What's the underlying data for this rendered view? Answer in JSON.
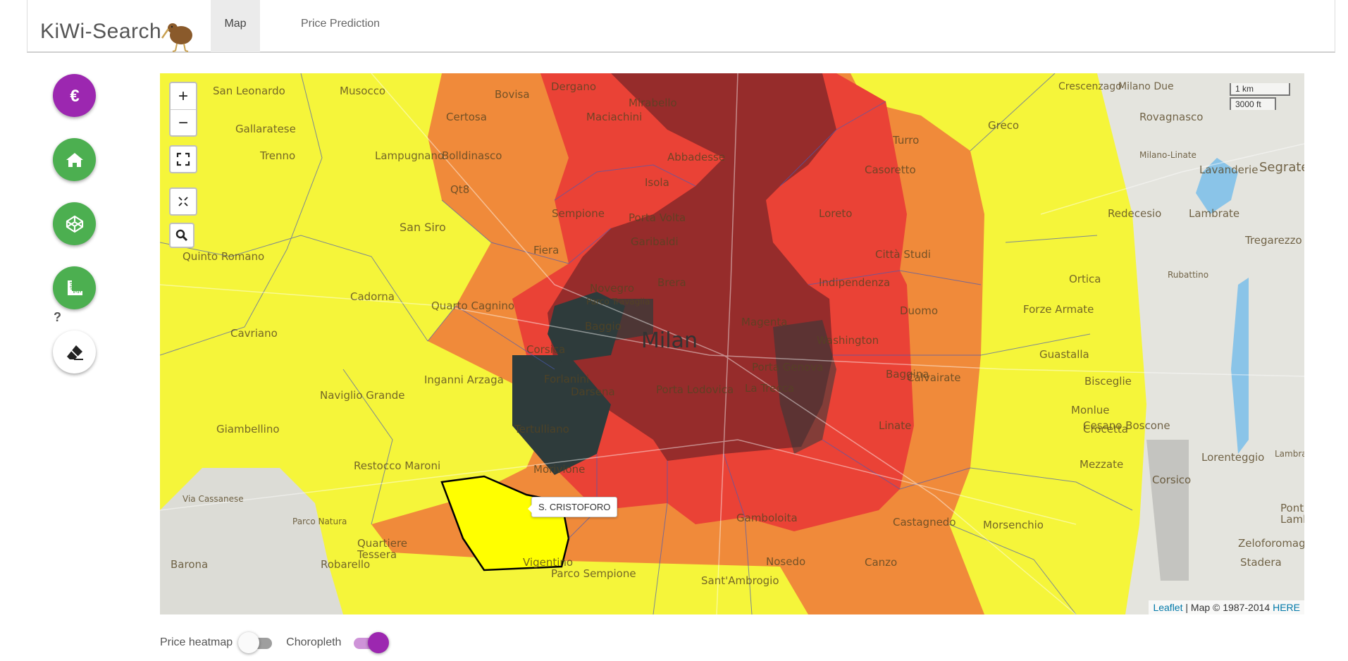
{
  "app": {
    "brand": "KiWi-Search",
    "tabs": [
      {
        "label": "Map",
        "active": true
      },
      {
        "label": "Price Prediction",
        "active": false
      }
    ]
  },
  "sidebar": {
    "buttons": [
      {
        "name": "price-button",
        "icon": "euro-icon",
        "color": "#9c27b0"
      },
      {
        "name": "home-button",
        "icon": "home-icon",
        "color": "#4caf50"
      },
      {
        "name": "codepen-button",
        "icon": "cube-icon",
        "color": "#4caf50"
      },
      {
        "name": "measure-button",
        "icon": "ruler-icon",
        "color": "#4caf50"
      },
      {
        "name": "eraser-button",
        "icon": "eraser-icon",
        "color": "#ffffff"
      }
    ],
    "help": "?"
  },
  "map": {
    "zoom_in": "+",
    "zoom_out": "−",
    "scale_km": "1 km",
    "scale_ft": "3000 ft",
    "attribution_link": "Leaflet",
    "attribution_text": " | Map © 1987-2014 ",
    "attribution_here": "HERE",
    "tooltip": "S. CRISTOFORO",
    "city_label": "Milan",
    "labels": [
      "San Leonardo",
      "Musocco",
      "Dergano",
      "Bovisa",
      "Mirabello",
      "Greco",
      "Crescenzago",
      "Milano Due",
      "Rovagnasco",
      "Certosa",
      "Maciachini",
      "Gallaratese",
      "Bolldinasco",
      "Turro",
      "Segrate",
      "Lavanderie",
      "Trenno",
      "Lampugnano",
      "Abbadesse",
      "Casoretto",
      "Isola",
      "Qt8",
      "Sempione",
      "Porta Volta",
      "Loreto",
      "Lambrate",
      "Redecesio",
      "Tregarezzo",
      "San Siro",
      "Garibaldi",
      "Città Studi",
      "Fiera",
      "Quinto Romano",
      "Brera",
      "Indipendenza",
      "Ortica",
      "Novegro",
      "Cadorna",
      "Quarto Cagnino",
      "Forze Armate",
      "Cavriano",
      "Baggio",
      "Magenta",
      "Duomo",
      "Corsica",
      "Washington",
      "Guastalla",
      "Forlanini",
      "Porta Genova",
      "Crocetta",
      "Calvairate",
      "Baggina",
      "Inganni Arzaga",
      "Bisceglie",
      "Naviglio Grande",
      "Darsena",
      "Porta Lodovica",
      "La Trecca",
      "Monlue",
      "Cesano Boscone",
      "Giambellino",
      "Tertulliano",
      "Linate",
      "Lorenteggio",
      "Restocco Maroni",
      "Morivione",
      "Gamboloita",
      "Castagnedo",
      "Morsenchio",
      "Mezzate",
      "Ponte Lambro",
      "Corsico",
      "Robarello",
      "Quartiere Tessera",
      "Barona",
      "Vigentino",
      "Nosedo",
      "Canzo",
      "Zeloforomagno",
      "Stadera",
      "Sant'Ambrogio",
      "Parco Sempione",
      "Parco Travaglia",
      "Parco Natura",
      "Via Cassanese",
      "Milano-Linate",
      "Lambrate",
      "Rubattino"
    ]
  },
  "layers": {
    "heatmap_label": "Price heatmap",
    "heatmap_on": false,
    "choropleth_label": "Choropleth",
    "choropleth_on": true
  },
  "colors": {
    "accent": "#9c27b0",
    "green": "#4caf50",
    "yellow": "#f5f53a",
    "orange": "#f08a3a",
    "red": "#ea4236",
    "darkred": "#8e2a2a",
    "darkest": "#2e3b3b"
  }
}
